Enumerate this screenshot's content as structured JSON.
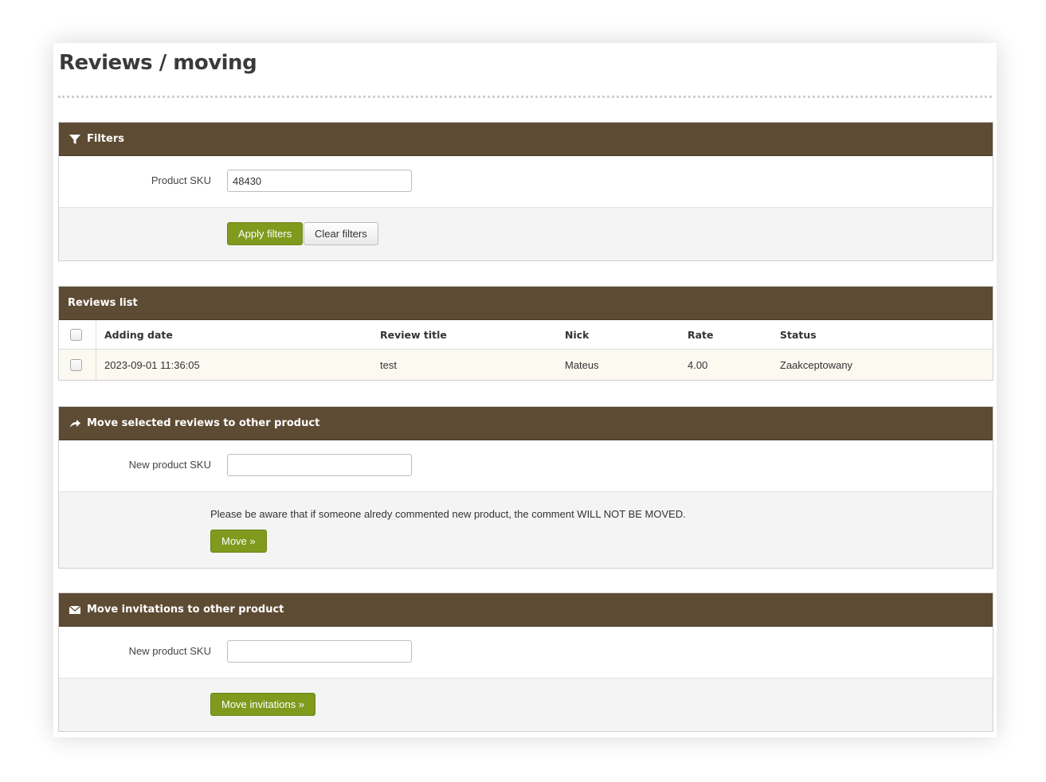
{
  "page": {
    "title": "Reviews / moving"
  },
  "filters": {
    "heading": "Filters",
    "sku_label": "Product SKU",
    "sku_value": "48430",
    "apply_label": "Apply filters",
    "clear_label": "Clear filters"
  },
  "reviews": {
    "heading": "Reviews list",
    "columns": [
      "Adding date",
      "Review title",
      "Nick",
      "Rate",
      "Status"
    ],
    "rows": [
      {
        "date": "2023-09-01 11:36:05",
        "title": "test",
        "nick": "Mateus",
        "rate": "4.00",
        "status": "Zaakceptowany",
        "checked": false
      }
    ]
  },
  "move_reviews": {
    "heading": "Move selected reviews to other product",
    "sku_label": "New product SKU",
    "sku_value": "",
    "note": "Please be aware that if someone alredy commented new product, the comment WILL NOT BE MOVED.",
    "button_label": "Move »"
  },
  "move_invitations": {
    "heading": "Move invitations to other product",
    "sku_label": "New product SKU",
    "sku_value": "",
    "button_label": "Move invitations »"
  },
  "colors": {
    "header_bg": "#5e4b33",
    "primary_button": "#7f9a1d",
    "row_bg": "#fcf9f1"
  },
  "icons": {
    "filters": "filter-icon",
    "move_reviews": "share-arrow-icon",
    "move_invitations": "envelope-icon"
  }
}
